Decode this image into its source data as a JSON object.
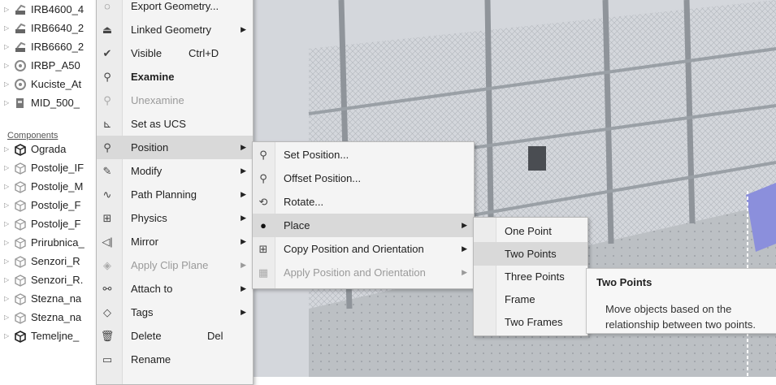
{
  "tree": {
    "items": [
      {
        "label": "IRB4600_4",
        "icon": "robot-icon"
      },
      {
        "label": "IRB6640_2",
        "icon": "robot-icon"
      },
      {
        "label": "IRB6660_2",
        "icon": "robot-icon"
      },
      {
        "label": "IRBP_A50",
        "icon": "positioner-icon"
      },
      {
        "label": "Kuciste_At",
        "icon": "positioner-icon"
      },
      {
        "label": "MID_500_",
        "icon": "welder-icon"
      },
      {
        "label": "Ograda",
        "icon": "component-icon"
      },
      {
        "label": "Postolje_IF",
        "icon": "component-icon"
      },
      {
        "label": "Postolje_M",
        "icon": "component-icon"
      },
      {
        "label": "Postolje_F",
        "icon": "component-icon"
      },
      {
        "label": "Postolje_F",
        "icon": "component-icon"
      },
      {
        "label": "Prirubnica_",
        "icon": "component-icon"
      },
      {
        "label": "Senzori_R",
        "icon": "component-icon"
      },
      {
        "label": "Senzori_R.",
        "icon": "component-icon"
      },
      {
        "label": "Stezna_na",
        "icon": "component-icon"
      },
      {
        "label": "Stezna_na",
        "icon": "component-icon"
      },
      {
        "label": "Temeljne_",
        "icon": "component-icon"
      }
    ],
    "section_label": "Components"
  },
  "context_menu": {
    "items": [
      {
        "label": "Export Geometry...",
        "icon": "export-icon"
      },
      {
        "label": "Linked Geometry",
        "icon": "linked-geometry-icon"
      },
      {
        "label": "Visible",
        "shortcut": "Ctrl+D",
        "icon": "checkmark-icon"
      },
      {
        "label": "Examine",
        "icon": "examine-icon"
      },
      {
        "label": "Unexamine",
        "icon": "unexamine-icon"
      },
      {
        "label": "Set as UCS",
        "icon": "ucs-icon"
      },
      {
        "label": "Position",
        "icon": "position-icon"
      },
      {
        "label": "Modify",
        "icon": "modify-icon"
      },
      {
        "label": "Path Planning",
        "icon": "path-planning-icon"
      },
      {
        "label": "Physics",
        "icon": "physics-icon"
      },
      {
        "label": "Mirror",
        "icon": "mirror-icon"
      },
      {
        "label": "Apply Clip Plane",
        "icon": "clip-plane-icon"
      },
      {
        "label": "Attach to",
        "icon": "attach-icon"
      },
      {
        "label": "Tags",
        "icon": "tag-icon"
      },
      {
        "label": "Delete",
        "shortcut": "Del",
        "icon": "trash-icon"
      },
      {
        "label": "Rename",
        "icon": "rename-icon"
      }
    ]
  },
  "position_submenu": {
    "items": [
      {
        "label": "Set Position...",
        "icon": "set-position-icon"
      },
      {
        "label": "Offset Position...",
        "icon": "offset-position-icon"
      },
      {
        "label": "Rotate...",
        "icon": "rotate-icon"
      },
      {
        "label": "Place",
        "icon": "place-pin-icon"
      },
      {
        "label": "Copy Position and Orientation",
        "icon": "copy-position-icon"
      },
      {
        "label": "Apply Position and Orientation",
        "icon": "apply-position-icon"
      }
    ]
  },
  "place_submenu": {
    "items": [
      {
        "label": "One Point"
      },
      {
        "label": "Two Points"
      },
      {
        "label": "Three Points"
      },
      {
        "label": "Frame"
      },
      {
        "label": "Two Frames"
      }
    ]
  },
  "tooltip": {
    "title": "Two Points",
    "description": "Move objects based on the relationship between two points."
  }
}
